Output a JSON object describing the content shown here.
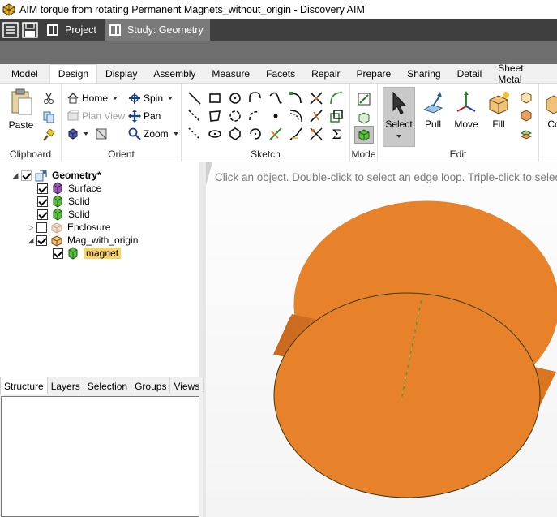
{
  "window": {
    "title": "AIM torque from rotating Permanent Magnets_without_origin - Discovery AIM"
  },
  "tabstrip": {
    "project_label": "Project",
    "study_label": "Study: Geometry"
  },
  "ribbon_tabs": [
    "Model",
    "Design",
    "Display",
    "Assembly",
    "Measure",
    "Facets",
    "Repair",
    "Prepare",
    "Sharing",
    "Detail",
    "Sheet Metal"
  ],
  "active_ribbon_tab": "Design",
  "ribbon": {
    "clipboard": {
      "label": "Clipboard",
      "paste": "Paste"
    },
    "orient": {
      "label": "Orient",
      "home": "Home",
      "plan_view": "Plan View",
      "spin": "Spin",
      "pan": "Pan",
      "zoom": "Zoom"
    },
    "sketch": {
      "label": "Sketch"
    },
    "mode": {
      "label": "Mode"
    },
    "edit": {
      "label": "Edit",
      "select": "Select",
      "pull": "Pull",
      "move": "Move",
      "fill": "Fill",
      "overflow": "Co"
    }
  },
  "tree": {
    "root": "Geometry*",
    "items": [
      {
        "label": "Surface",
        "checked": true
      },
      {
        "label": "Solid",
        "checked": true
      },
      {
        "label": "Solid",
        "checked": true
      },
      {
        "label": "Enclosure",
        "checked": false
      },
      {
        "label": "Mag_with_origin",
        "checked": true
      },
      {
        "label": "magnet",
        "checked": true,
        "selected": true
      }
    ]
  },
  "panel_tabs": [
    "Structure",
    "Layers",
    "Selection",
    "Groups",
    "Views"
  ],
  "active_panel_tab": "Structure",
  "viewport": {
    "hint": "Click an object. Double-click to select an edge loop. Triple-click to select",
    "solid_color": "#E8822A"
  },
  "colors": {
    "tabstrip": "#3F3F3F",
    "study_tab": "#7A7A7A",
    "selection_highlight": "#F8D36A"
  }
}
